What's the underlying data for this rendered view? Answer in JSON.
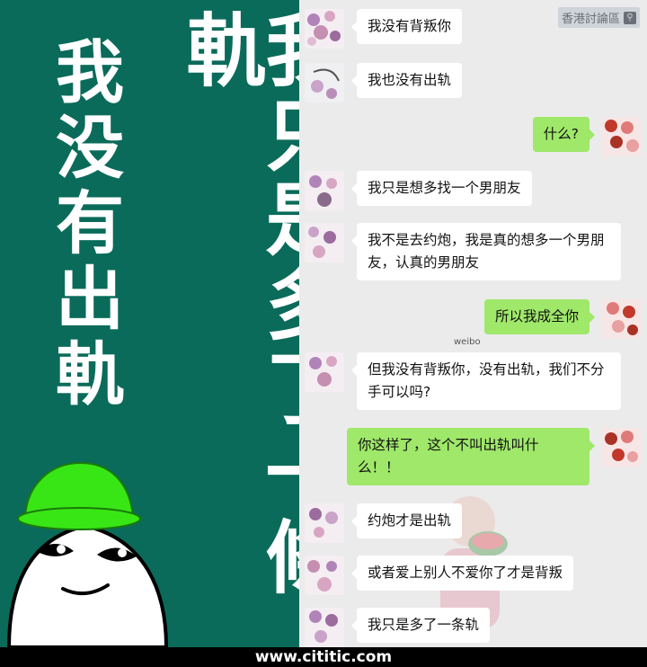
{
  "left": {
    "slogan_left": "我没有出軌",
    "slogan_right": "我只是多了一條軌"
  },
  "watermark": "香港討論區",
  "messages": [
    {
      "side": "in",
      "text": "我没有背叛你"
    },
    {
      "side": "in",
      "text": "我也没有出轨"
    },
    {
      "side": "out",
      "text": "什么?"
    },
    {
      "side": "in",
      "text": "我只是想多找一个男朋友"
    },
    {
      "side": "in",
      "text": "我不是去约炮，我是真的想多一个男朋友，认真的男朋友"
    },
    {
      "side": "out",
      "text": "所以我成全你"
    },
    {
      "side": "in",
      "text": "但我没有背叛你，没有出轨，我们不分手可以吗?"
    },
    {
      "side": "out",
      "text": "你这样了，这个不叫出轨叫什么！！"
    },
    {
      "side": "in",
      "text": "约炮才是出轨"
    },
    {
      "side": "in",
      "text": "或者爱上别人不爱你了才是背叛"
    },
    {
      "side": "in",
      "text": "我只是多了一条轨"
    }
  ],
  "weibo_mark": "weibo",
  "footer": "www.cititic.com",
  "colors": {
    "left_bg": "#0a6b5a",
    "chat_bg": "#ebebeb",
    "bubble_out": "#9fe86a",
    "bubble_in": "#ffffff",
    "meme_hat": "#39e615"
  }
}
